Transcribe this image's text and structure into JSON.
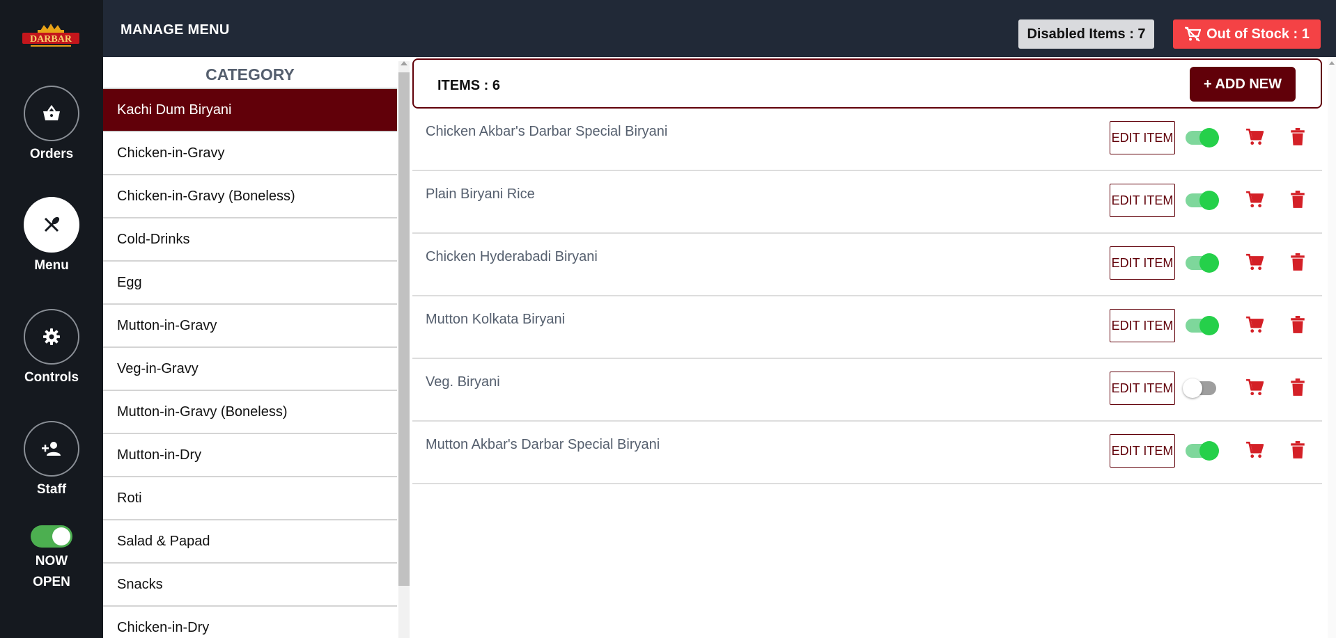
{
  "brand": {
    "logo_text": "DARBAR",
    "logo_icon": "crown-logo"
  },
  "header": {
    "title": "MANAGE MENU",
    "disabled_items": "Disabled Items : 7",
    "out_of_stock": "Out of Stock : 1"
  },
  "sidebar": {
    "items": [
      {
        "label": "Orders",
        "icon": "basket-icon",
        "active": false
      },
      {
        "label": "Menu",
        "icon": "fork-spoon-icon",
        "active": true
      },
      {
        "label": "Controls",
        "icon": "gear-icon",
        "active": false
      },
      {
        "label": "Staff",
        "icon": "add-person-icon",
        "active": false
      }
    ],
    "open_status": {
      "label_line1": "NOW",
      "label_line2": "OPEN",
      "on": true
    }
  },
  "category": {
    "heading": "CATEGORY",
    "items": [
      "Kachi Dum Biryani",
      "Chicken-in-Gravy",
      "Chicken-in-Gravy (Boneless)",
      "Cold-Drinks",
      "Egg",
      "Mutton-in-Gravy",
      "Veg-in-Gravy",
      "Mutton-in-Gravy (Boneless)",
      "Mutton-in-Dry",
      "Roti",
      "Salad & Papad",
      "Snacks",
      "Chicken-in-Dry"
    ],
    "selected": "Kachi Dum Biryani"
  },
  "items_panel": {
    "count_label": "ITEMS : 6",
    "add_new_label": "+ ADD NEW",
    "edit_label": "EDIT ITEM",
    "items": [
      {
        "name": "Chicken Akbar's Darbar Special Biryani",
        "enabled": true
      },
      {
        "name": "Plain Biryani Rice",
        "enabled": true
      },
      {
        "name": "Chicken Hyderabadi Biryani",
        "enabled": true
      },
      {
        "name": "Mutton Kolkata Biryani",
        "enabled": true
      },
      {
        "name": "Veg. Biryani",
        "enabled": false
      },
      {
        "name": "Mutton Akbar's Darbar Special Biryani",
        "enabled": true
      }
    ]
  },
  "colors": {
    "sidebar_bg": "#15191f",
    "header_bg": "#212937",
    "brand_maroon": "#610009",
    "danger_red": "#f44245",
    "toggle_green": "#25d04a"
  }
}
